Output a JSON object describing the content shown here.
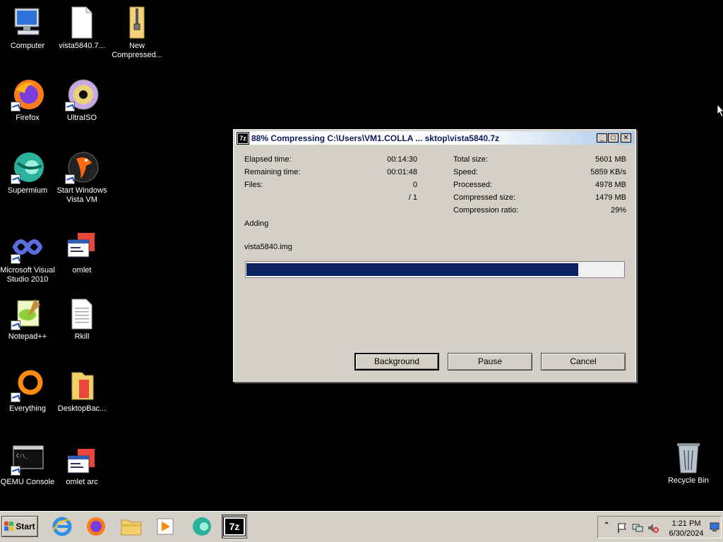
{
  "desktop": {
    "icons": [
      {
        "label": "Computer"
      },
      {
        "label": "vista5840.7..."
      },
      {
        "label": "New Compressed..."
      },
      {
        "label": "Firefox"
      },
      {
        "label": "UltraISO"
      },
      {
        "label": "Supermium"
      },
      {
        "label": "Start Windows Vista VM"
      },
      {
        "label": "Microsoft Visual Studio 2010"
      },
      {
        "label": "omlet"
      },
      {
        "label": "Notepad++"
      },
      {
        "label": "Rkill"
      },
      {
        "label": "Everything"
      },
      {
        "label": "DesktopBac..."
      },
      {
        "label": "QEMU Console"
      },
      {
        "label": "omlet arc"
      },
      {
        "label": "Recycle Bin"
      }
    ]
  },
  "dialog": {
    "app_icon_text": "7z",
    "title": "88% Compressing C:\\Users\\VM1.COLLA ... sktop\\vista5840.7z",
    "minimize_glyph": "_",
    "maximize_glyph": "□",
    "close_glyph": "✕",
    "stats_left": [
      {
        "label": "Elapsed time:",
        "value": "00:14:30"
      },
      {
        "label": "Remaining time:",
        "value": "00:01:48"
      },
      {
        "label": "Files:",
        "value": "0"
      },
      {
        "label": "",
        "value": "/ 1"
      }
    ],
    "stats_right": [
      {
        "label": "Total size:",
        "value": "5601 MB"
      },
      {
        "label": "Speed:",
        "value": "5859 KB/s"
      },
      {
        "label": "Processed:",
        "value": "4978 MB"
      },
      {
        "label": "Compressed size:",
        "value": "1479 MB"
      },
      {
        "label": "Compression ratio:",
        "value": "29%"
      }
    ],
    "status": "Adding",
    "current_file": "vista5840.img",
    "progress_fraction": 0.88,
    "buttons": {
      "background": "Background",
      "pause": "Pause",
      "cancel": "Cancel"
    }
  },
  "taskbar": {
    "start_label": "Start",
    "active_app_text": "7z",
    "clock_time": "1:21 PM",
    "clock_date": "6/30/2024"
  },
  "colors": {
    "progress_fill": "#0b2461",
    "desktop_bg": "#000000"
  }
}
